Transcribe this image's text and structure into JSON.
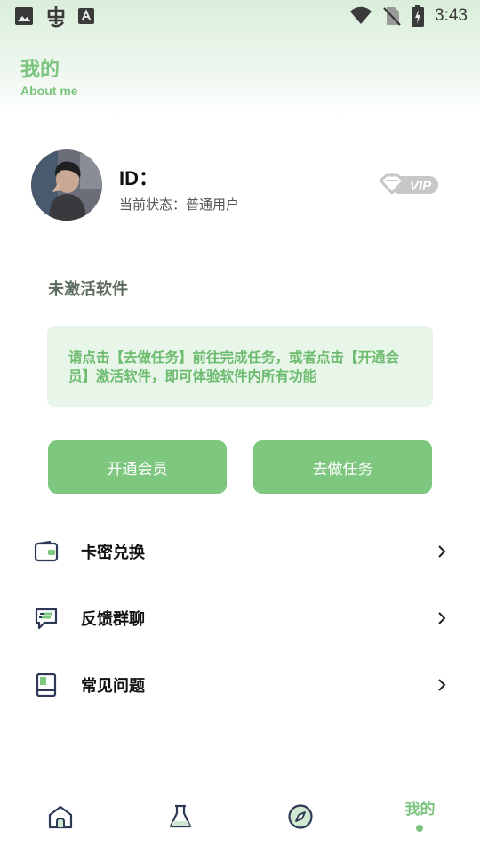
{
  "status_bar": {
    "time": "3:43",
    "icons_left": [
      "image-icon",
      "bug-icon",
      "font-icon"
    ],
    "icons_right": [
      "wifi-icon",
      "no-sim-icon",
      "battery-charging-icon"
    ]
  },
  "header": {
    "title": "我的",
    "subtitle": "About me"
  },
  "profile": {
    "id_label": "ID：",
    "status_label": "当前状态：",
    "status_value": "普通用户",
    "badge_text": "VIP"
  },
  "activation": {
    "title": "未激活软件",
    "notice": "请点击【去做任务】前往完成任务，或者点击【开通会员】激活软件，即可体验软件内所有功能"
  },
  "actions": {
    "open_vip": "开通会员",
    "do_task": "去做任务"
  },
  "menu": [
    {
      "label": "卡密兑换",
      "icon": "wallet-icon"
    },
    {
      "label": "反馈群聊",
      "icon": "chat-icon"
    },
    {
      "label": "常见问题",
      "icon": "book-icon"
    }
  ],
  "bottom_nav": {
    "items": [
      "home-icon",
      "flask-icon",
      "compass-icon"
    ],
    "active_label": "我的"
  },
  "colors": {
    "accent": "#7ec77f",
    "accent_text": "#7cc47e",
    "notice_bg": "#e8f5e9"
  }
}
